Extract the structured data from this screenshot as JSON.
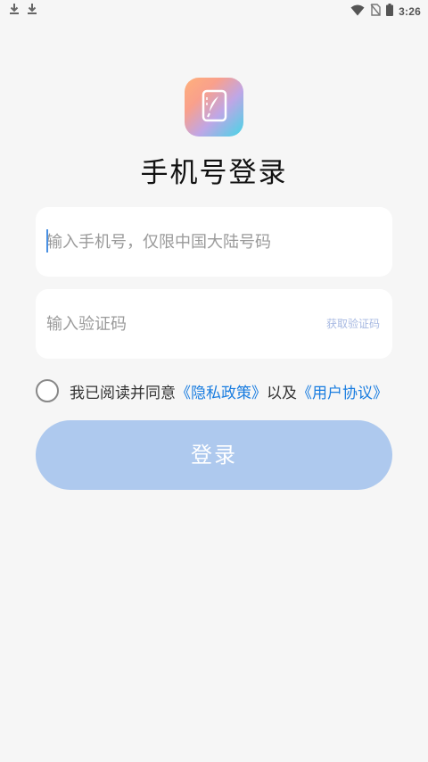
{
  "status_bar": {
    "time": "3:26",
    "left_icons": [
      "download-icon",
      "download-icon"
    ],
    "right_icons": [
      "wifi-icon",
      "no-sim-icon",
      "battery-icon"
    ]
  },
  "logo": {
    "icon": "app-logo-icon"
  },
  "title": "手机号登录",
  "phone_input": {
    "placeholder": "输入手机号，仅限中国大陆号码",
    "value": ""
  },
  "code_input": {
    "placeholder": "输入验证码",
    "value": ""
  },
  "get_code_label": "获取验证码",
  "agreement": {
    "prefix": "我已阅读并同意",
    "privacy_link": "《隐私政策》",
    "middle": "以及",
    "terms_link": "《用户协议》",
    "checked": false
  },
  "login_button_label": "登录",
  "colors": {
    "background": "#f6f6f6",
    "link": "#1a7de0",
    "login_button": "#aec9ee",
    "get_code": "#a7b9e2"
  }
}
